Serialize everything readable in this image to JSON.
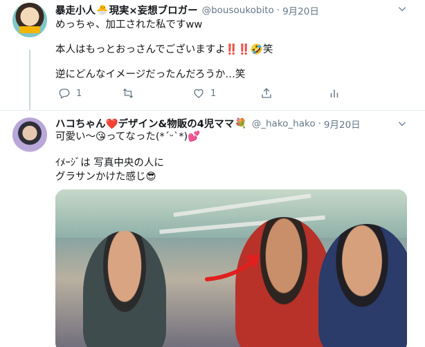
{
  "tweet1": {
    "display_name": "暴走小人",
    "name_suffix": "現実×妄想ブロガー",
    "handle": "@bousoukobito",
    "time": "9月20日",
    "lines": [
      "めっちゃ、加工された私ですww",
      "本人はもっとおっさんでございますよ‼️‼️🤣笑",
      "逆にどんなイメージだったんだろうか…笑"
    ],
    "reply_count": "1",
    "retweet_count": "",
    "like_count": "1"
  },
  "tweet2": {
    "display_name": "ハコちゃん❤️デザイン&物販の4児ママ",
    "handle": "@_hako_hako",
    "time": "9月20日",
    "lines": [
      "可愛い〜😘ってなった(*´ᵕ`*)💕",
      "ｲﾒｰｼﾞは 写真中央の人に",
      "グラサンかけた感じ😎"
    ]
  },
  "colors": {
    "text": "#14171a",
    "secondary": "#657786",
    "divider": "#e6ecf0"
  },
  "icons": [
    "chevron-down-icon",
    "reply-icon",
    "retweet-icon",
    "like-icon",
    "share-icon",
    "analytics-icon"
  ]
}
